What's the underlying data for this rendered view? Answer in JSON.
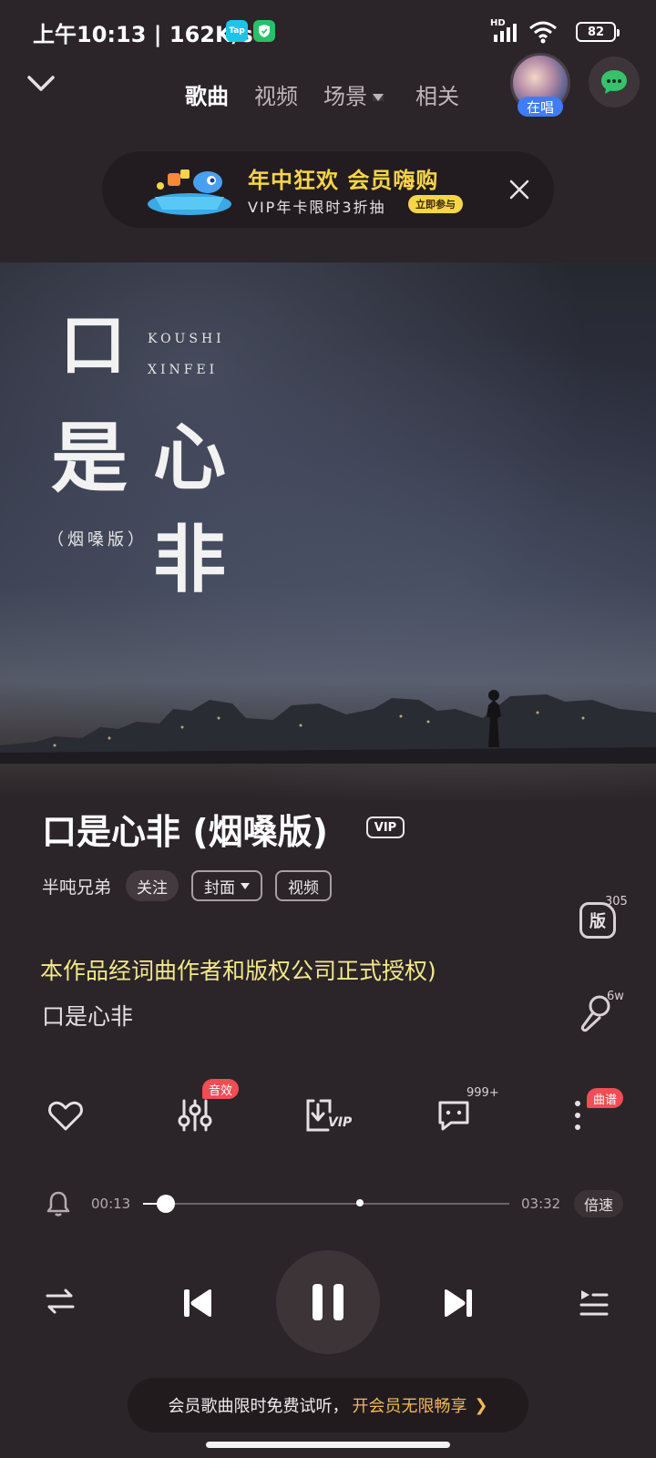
{
  "status_bar": {
    "time": "上午10:13",
    "separator": "|",
    "net_speed": "162K/s",
    "app_badge_1": "Tap",
    "battery": "82",
    "hd_label": "HD"
  },
  "nav": {
    "tabs": [
      {
        "label": "歌曲",
        "active": true
      },
      {
        "label": "视频",
        "active": false
      },
      {
        "label": "场景",
        "active": false
      },
      {
        "label": "相关",
        "active": false
      }
    ],
    "singing_tag": "在唱"
  },
  "banner": {
    "title": "年中狂欢 会员嗨购",
    "subtitle": "VIP年卡限时3折抽",
    "pill": "立即参与"
  },
  "album_art": {
    "char_1": "口",
    "char_2": "是",
    "char_3": "心",
    "char_4": "非",
    "en_1": "KOUSHI",
    "en_2": "XINFEI",
    "version": "（烟嗓版）"
  },
  "song": {
    "title": "口是心非 (烟嗓版)",
    "vip": "VIP",
    "artist": "半吨兄弟",
    "follow": "关注",
    "cover": "封面",
    "video": "视频",
    "version_icon": "版",
    "version_count": "305",
    "singalong_count": "6w"
  },
  "lyrics": {
    "line1": "本作品经词曲作者和版权公司正式授权)",
    "line2": "口是心非"
  },
  "actions": {
    "sound_effect_badge": "音效",
    "comment_count": "999+",
    "score_badge": "曲谱",
    "download_vip": "VIP"
  },
  "progress": {
    "current": "00:13",
    "total": "03:32",
    "speed": "倍速",
    "fraction": 0.061
  },
  "promo": {
    "plain": "会员歌曲限时免费试听，",
    "gold": "开会员无限畅享",
    "arrow": "❯"
  },
  "colors": {
    "background": "#2b2428",
    "lyric_highlight": "#f2e98a",
    "badge_red": "#f04d54",
    "banner_yellow": "#f7d448",
    "promo_gold": "#f1b85a",
    "singing_blue": "#3f7cf5"
  }
}
